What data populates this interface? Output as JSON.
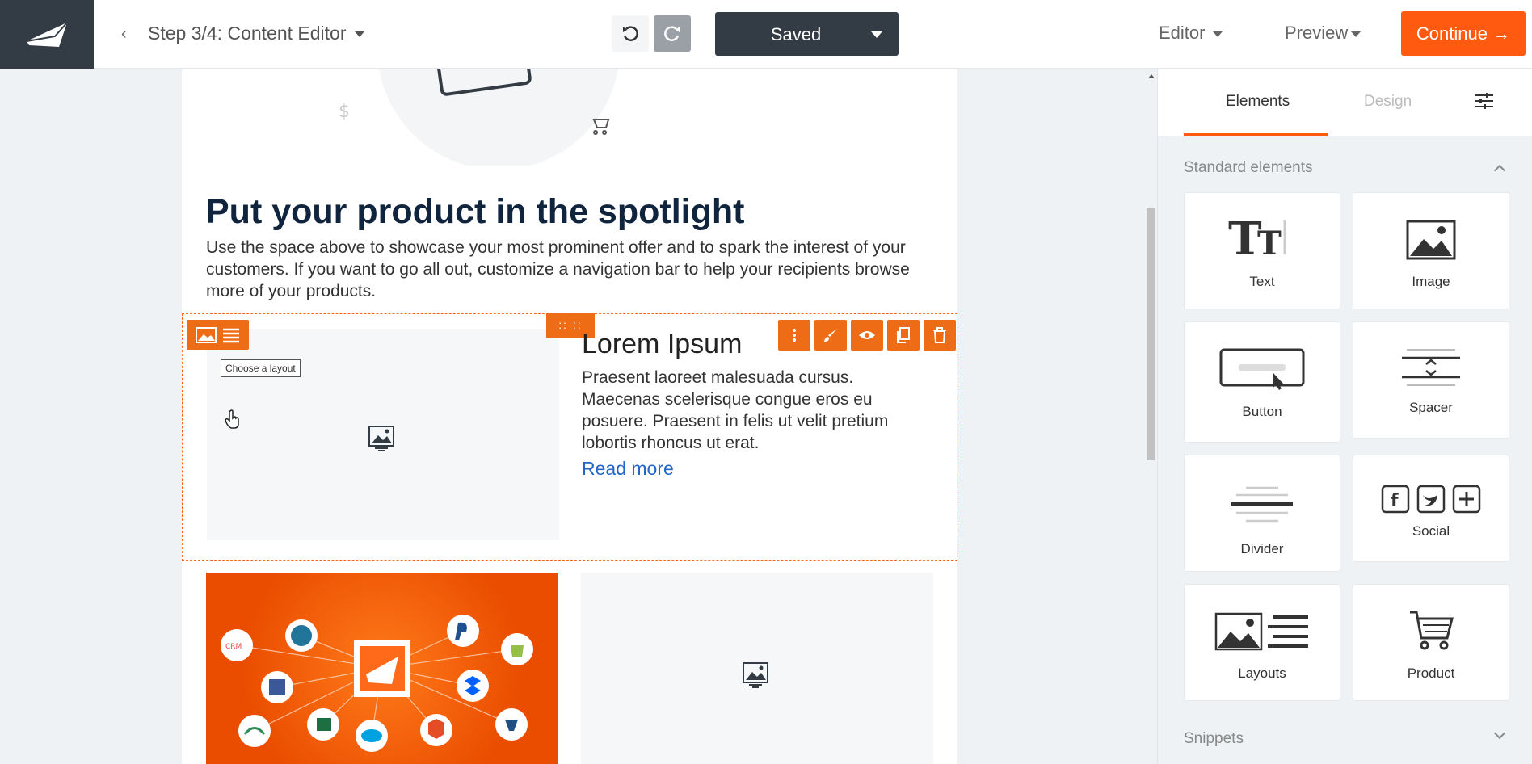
{
  "header": {
    "back": "‹",
    "step": "Step 3/4: Content Editor",
    "saved": "Saved",
    "menu_editor": "Editor",
    "menu_preview": "Preview",
    "continue": "Continue →"
  },
  "email": {
    "headline": "Put your product in the spotlight",
    "intro": "Use the space above to showcase your most prominent offer and to spark the interest of your customers. If you want to go all out, customize a navigation bar to help your recipients browse more of your products.",
    "tooltip": "Choose a layout",
    "drag_handle": ":: ::",
    "lorem_title": "Lorem Ipsum",
    "lorem_body": "Praesent laoreet malesuada cursus. Maecenas scelerisque congue eros eu posuere. Praesent in felis ut velit pretium lobortis rhoncus ut erat.",
    "read_more": "Read more"
  },
  "panel": {
    "tab_elements": "Elements",
    "tab_design": "Design",
    "section_standard": "Standard elements",
    "section_snippets": "Snippets",
    "elements": [
      "Text",
      "Image",
      "Button",
      "Spacer",
      "Divider",
      "Social",
      "Layouts",
      "Product"
    ]
  },
  "colors": {
    "accent": "#ff5a0f",
    "dark": "#333b44",
    "link": "#2166c8"
  }
}
